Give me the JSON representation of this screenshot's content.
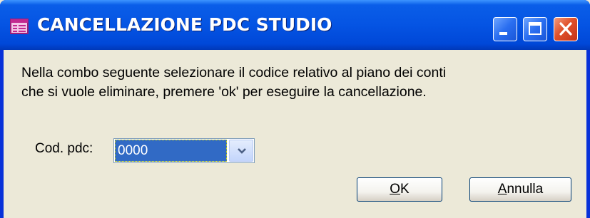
{
  "window": {
    "title": "CANCELLAZIONE PDC STUDIO",
    "controls": [
      "minimize-icon",
      "maximize-icon",
      "close-icon"
    ]
  },
  "message": {
    "line1": "Nella combo seguente selezionare il codice relativo al piano dei conti",
    "line2": "che si vuole eliminare, premere 'ok' per eseguire la cancellazione."
  },
  "form": {
    "cod_pdc_label": "Cod. pdc:",
    "cod_pdc_value": "0000"
  },
  "buttons": {
    "ok_accel": "O",
    "ok_rest": "K",
    "cancel_accel": "A",
    "cancel_rest": "nnulla"
  },
  "colors": {
    "titlebar": "#0554e3",
    "selection": "#316ac5",
    "close_button": "#e0502a"
  }
}
